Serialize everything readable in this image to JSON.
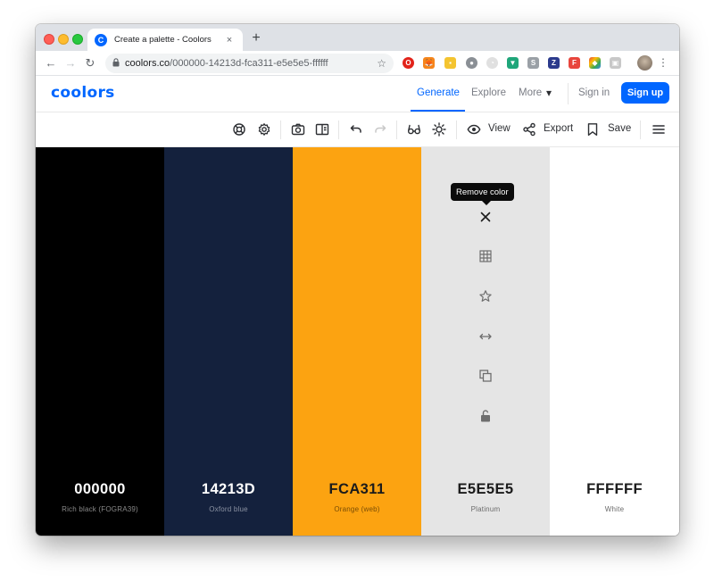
{
  "browser": {
    "tab_title": "Create a palette - Coolors",
    "tab_favicon": "C",
    "tab_close": "×",
    "new_tab": "+",
    "url_host": "coolors.co",
    "url_path": "/000000-14213d-fca311-e5e5e5-ffffff",
    "nav": {
      "back": "←",
      "forward": "→",
      "reload": "↻"
    },
    "star": "☆",
    "lock": "🔒",
    "menu": "⋮",
    "extensions": [
      {
        "label": "O",
        "color": "#e2231a"
      },
      {
        "label": "🦊",
        "color": "#f6851b"
      },
      {
        "label": "▪",
        "color": "#f4c430"
      },
      {
        "label": "●",
        "color": "#8a8f95"
      },
      {
        "label": "◔",
        "color": "#bdbdbd"
      },
      {
        "label": "▼",
        "color": "#1fa67a"
      },
      {
        "label": "S",
        "color": "#9aa0a6"
      },
      {
        "label": "Z",
        "color": "#2b3a8c"
      },
      {
        "label": "F",
        "color": "#e8453c"
      },
      {
        "label": "◆",
        "color": "#7b61ff"
      },
      {
        "label": "▣",
        "color": "#b0b0b0"
      }
    ]
  },
  "header": {
    "logo": "coolors",
    "nav": [
      "Generate",
      "Explore",
      "More"
    ],
    "more_chevron": "▾",
    "signin": "Sign in",
    "signup": "Sign up"
  },
  "toolbar": {
    "view_label": "View",
    "export_label": "Export",
    "save_label": "Save"
  },
  "palette": {
    "colors": [
      {
        "hex": "000000",
        "name": "Rich black (FOGRA39)",
        "bg": "#000000",
        "text": "#ffffff",
        "sub": "#8a8a8a"
      },
      {
        "hex": "14213D",
        "name": "Oxford blue",
        "bg": "#14213d",
        "text": "#ffffff",
        "sub": "#8c93a3"
      },
      {
        "hex": "FCA311",
        "name": "Orange (web)",
        "bg": "#fca311",
        "text": "#1b1b1b",
        "sub": "#7a4d05"
      },
      {
        "hex": "E5E5E5",
        "name": "Platinum",
        "bg": "#e5e5e5",
        "text": "#1b1b1b",
        "sub": "#6b6b6b"
      },
      {
        "hex": "FFFFFF",
        "name": "White",
        "bg": "#ffffff",
        "text": "#1b1b1b",
        "sub": "#6b6b6b"
      }
    ],
    "hover_column": 3,
    "tooltip": "Remove color",
    "column_tools": [
      "close-icon",
      "grid-icon",
      "star-icon",
      "drag-handle-icon",
      "copy-icon",
      "lock-icon"
    ]
  }
}
